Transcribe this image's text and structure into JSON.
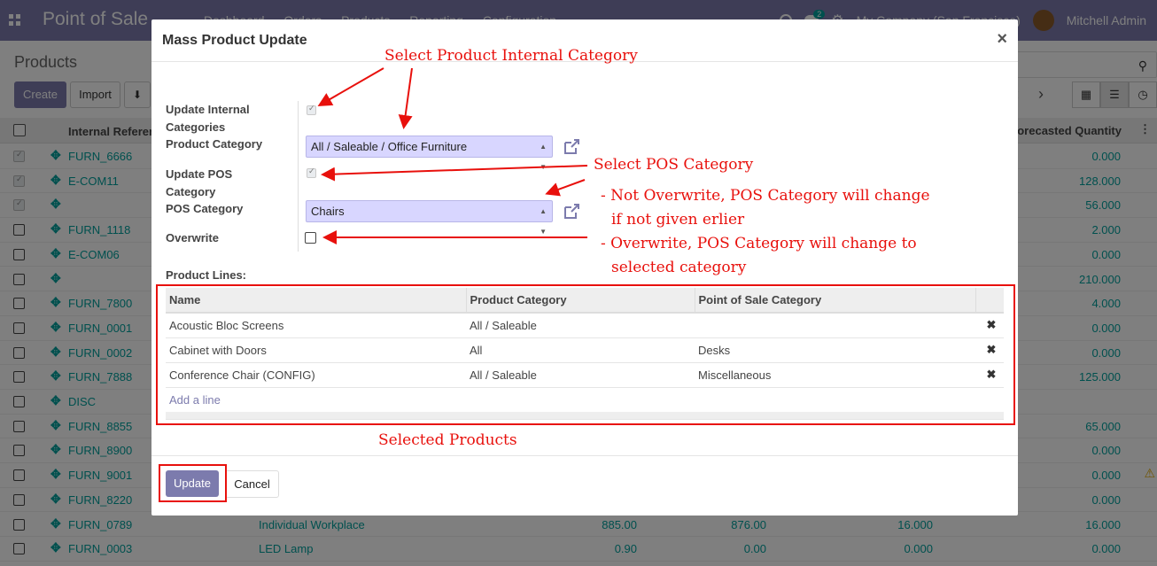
{
  "navbar": {
    "brand": "Point of Sale",
    "menu": [
      "Dashboard",
      "Orders",
      "Products",
      "Reporting",
      "Configuration"
    ],
    "chat_count": "2",
    "company": "My Company (San Francisco)",
    "user": "Mitchell Admin"
  },
  "control_panel": {
    "title": "Products",
    "create_label": "Create",
    "import_label": "Import"
  },
  "list": {
    "col_reference": "Internal Reference",
    "col_forecast": "Forecasted Quantity",
    "rows": [
      {
        "ref": "FURN_6666",
        "name": "",
        "c1": "",
        "c2": "",
        "c3": "",
        "qty": "0.000",
        "checked": true
      },
      {
        "ref": "E-COM11",
        "name": "",
        "c1": "",
        "c2": "",
        "c3": "",
        "qty": "128.000",
        "checked": true
      },
      {
        "ref": "",
        "name": "",
        "c1": "",
        "c2": "",
        "c3": "",
        "qty": "56.000",
        "checked": true
      },
      {
        "ref": "FURN_1118",
        "name": "",
        "c1": "",
        "c2": "",
        "c3": "",
        "qty": "2.000",
        "checked": false
      },
      {
        "ref": "E-COM06",
        "name": "",
        "c1": "",
        "c2": "",
        "c3": "",
        "qty": "0.000",
        "checked": false
      },
      {
        "ref": "",
        "name": "",
        "c1": "",
        "c2": "",
        "c3": "",
        "qty": "210.000",
        "checked": false
      },
      {
        "ref": "FURN_7800",
        "name": "",
        "c1": "",
        "c2": "",
        "c3": "",
        "qty": "4.000",
        "checked": false
      },
      {
        "ref": "FURN_0001",
        "name": "",
        "c1": "",
        "c2": "",
        "c3": "",
        "qty": "0.000",
        "checked": false
      },
      {
        "ref": "FURN_0002",
        "name": "",
        "c1": "",
        "c2": "",
        "c3": "",
        "qty": "0.000",
        "checked": false
      },
      {
        "ref": "FURN_7888",
        "name": "",
        "c1": "",
        "c2": "",
        "c3": "",
        "qty": "125.000",
        "checked": false
      },
      {
        "ref": "DISC",
        "name": "",
        "c1": "",
        "c2": "",
        "c3": "",
        "qty": "",
        "checked": false
      },
      {
        "ref": "FURN_8855",
        "name": "",
        "c1": "",
        "c2": "",
        "c3": "",
        "qty": "65.000",
        "checked": false
      },
      {
        "ref": "FURN_8900",
        "name": "",
        "c1": "",
        "c2": "",
        "c3": "",
        "qty": "0.000",
        "checked": false
      },
      {
        "ref": "FURN_9001",
        "name": "",
        "c1": "",
        "c2": "",
        "c3": "",
        "qty": "0.000",
        "checked": false,
        "warn": true
      },
      {
        "ref": "FURN_8220",
        "name": "",
        "c1": "",
        "c2": "",
        "c3": "",
        "qty": "0.000",
        "checked": false
      },
      {
        "ref": "FURN_0789",
        "name": "Individual Workplace",
        "c1": "885.00",
        "c2": "876.00",
        "c3": "16.000",
        "qty": "16.000",
        "checked": false
      },
      {
        "ref": "FURN_0003",
        "name": "LED Lamp",
        "c1": "0.90",
        "c2": "0.00",
        "c3": "0.000",
        "qty": "0.000",
        "checked": false
      }
    ]
  },
  "modal": {
    "title": "Mass Product Update",
    "close_glyph": "×",
    "update_internal_label": "Update Internal Categories",
    "product_category_label": "Product Category",
    "product_category_value": "All / Saleable / Office Furniture",
    "update_pos_label": "Update POS Category",
    "pos_category_label": "POS Category",
    "pos_category_value": "Chairs",
    "overwrite_label": "Overwrite",
    "product_lines_label": "Product Lines:",
    "lines_headers": [
      "Name",
      "Product Category",
      "Point of Sale Category"
    ],
    "lines": [
      {
        "name": "Acoustic Bloc Screens",
        "category": "All / Saleable",
        "pos": ""
      },
      {
        "name": "Cabinet with Doors",
        "category": "All",
        "pos": "Desks"
      },
      {
        "name": "Conference Chair (CONFIG)",
        "category": "All / Saleable",
        "pos": "Miscellaneous"
      }
    ],
    "add_line_label": "Add a line",
    "update_label": "Update",
    "cancel_label": "Cancel"
  },
  "annotations": {
    "internal_category": "Select Product Internal Category",
    "pos_category": "Select POS Category",
    "not_overwrite_1": "- Not Overwrite, POS Category will change",
    "not_overwrite_2": "if not given erlier",
    "overwrite_1": "- Overwrite, POS Category will change to",
    "overwrite_2": "selected category",
    "selected_products": "Selected Products"
  },
  "colors": {
    "brand": "#7c7bad",
    "link": "#00a09d",
    "annotation": "#e8100c",
    "select_bg": "#d8d6ff"
  }
}
